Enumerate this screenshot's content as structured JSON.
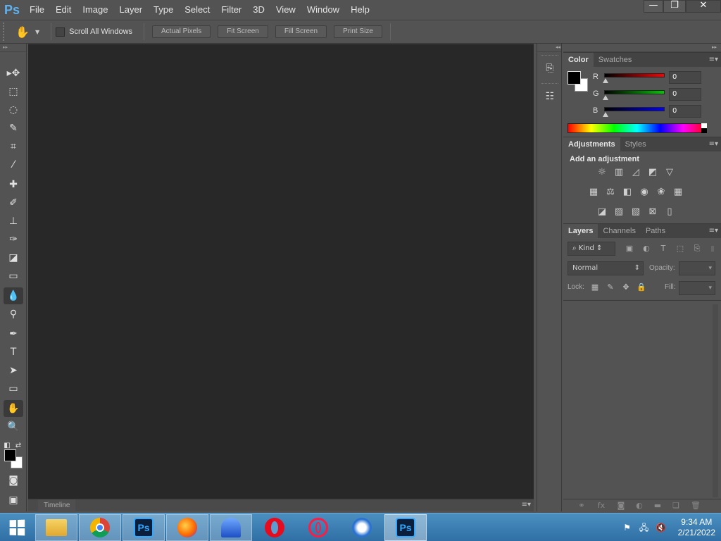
{
  "app": {
    "logo": "Ps"
  },
  "menu": [
    "File",
    "Edit",
    "Image",
    "Layer",
    "Type",
    "Select",
    "Filter",
    "3D",
    "View",
    "Window",
    "Help"
  ],
  "window_controls": {
    "minimize": "—",
    "restore": "❐",
    "close": "✕"
  },
  "options_bar": {
    "scroll_all_label": "Scroll All Windows",
    "scroll_all_checked": false,
    "buttons": [
      "Actual Pixels",
      "Fit Screen",
      "Fill Screen",
      "Print Size"
    ]
  },
  "tools": [
    {
      "name": "move-tool",
      "glyph": "▸✥"
    },
    {
      "name": "marquee-tool",
      "glyph": "⬚"
    },
    {
      "name": "lasso-tool",
      "glyph": "◌"
    },
    {
      "name": "quick-select-tool",
      "glyph": "✎"
    },
    {
      "name": "crop-tool",
      "glyph": "⌗"
    },
    {
      "name": "eyedropper-tool",
      "glyph": "⁄"
    },
    {
      "name": "healing-brush-tool",
      "glyph": "✚"
    },
    {
      "name": "brush-tool",
      "glyph": "✐"
    },
    {
      "name": "clone-stamp-tool",
      "glyph": "⊥"
    },
    {
      "name": "history-brush-tool",
      "glyph": "✑"
    },
    {
      "name": "eraser-tool",
      "glyph": "◪"
    },
    {
      "name": "gradient-tool",
      "glyph": "▭"
    },
    {
      "name": "blur-tool",
      "glyph": "💧",
      "active": true
    },
    {
      "name": "dodge-tool",
      "glyph": "⚲"
    },
    {
      "name": "pen-tool",
      "glyph": "✒"
    },
    {
      "name": "type-tool",
      "glyph": "T"
    },
    {
      "name": "path-selection-tool",
      "glyph": "➤"
    },
    {
      "name": "rectangle-tool",
      "glyph": "▭"
    },
    {
      "name": "hand-tool",
      "glyph": "✋",
      "active": true
    },
    {
      "name": "zoom-tool",
      "glyph": "🔍"
    }
  ],
  "colors": {
    "foreground": "#000000",
    "background": "#ffffff"
  },
  "canvas": {
    "bg": "#282828"
  },
  "timeline": {
    "label": "Timeline"
  },
  "color_panel": {
    "tabs": [
      "Color",
      "Swatches"
    ],
    "channels": [
      {
        "label": "R",
        "value": "0",
        "color": "#ff0000"
      },
      {
        "label": "G",
        "value": "0",
        "color": "#00c800"
      },
      {
        "label": "B",
        "value": "0",
        "color": "#0000ff"
      }
    ]
  },
  "adjustments_panel": {
    "tabs": [
      "Adjustments",
      "Styles"
    ],
    "title": "Add an adjustment"
  },
  "layers_panel": {
    "tabs": [
      "Layers",
      "Channels",
      "Paths"
    ],
    "kind_label": "Kind",
    "blend_mode": "Normal",
    "opacity_label": "Opacity:",
    "lock_label": "Lock:",
    "fill_label": "Fill:"
  },
  "taskbar": {
    "apps": [
      {
        "name": "file-explorer",
        "label": ""
      },
      {
        "name": "chrome",
        "label": ""
      },
      {
        "name": "photoshop-pinned",
        "label": "Ps"
      },
      {
        "name": "firefox",
        "label": ""
      },
      {
        "name": "app-blue",
        "label": ""
      },
      {
        "name": "opera",
        "label": "O"
      },
      {
        "name": "opera-gx",
        "label": "O"
      },
      {
        "name": "thunderbird",
        "label": ""
      },
      {
        "name": "photoshop-running",
        "label": "Ps"
      }
    ],
    "time": "9:34 AM",
    "date": "2/21/2022"
  }
}
